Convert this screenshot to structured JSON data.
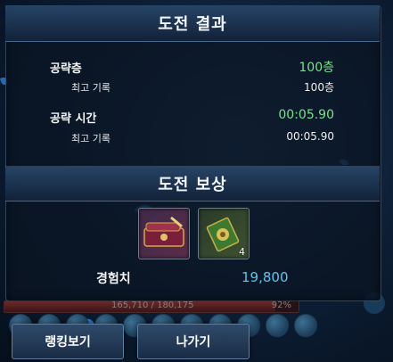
{
  "results": {
    "title": "도전 결과",
    "floor_label": "공략층",
    "floor_value": "100층",
    "floor_best_label": "최고 기록",
    "floor_best_value": "100층",
    "time_label": "공략 시간",
    "time_value": "00:05.90",
    "time_best_label": "최고 기록",
    "time_best_value": "00:05.90"
  },
  "rewards": {
    "title": "도전 보상",
    "items": [
      {
        "icon": "chest-icon",
        "count": ""
      },
      {
        "icon": "scroll-icon",
        "count": "4"
      }
    ],
    "exp_label": "경험치",
    "exp_value": "19,800"
  },
  "xp_bar": {
    "text": "165,710 / 180,175",
    "percent_text": "92%",
    "fraction": 0.92
  },
  "buttons": {
    "ranking": "랭킹보기",
    "exit": "나가기"
  },
  "colors": {
    "green": "#74e48a",
    "exp_blue": "#5fc4ec"
  }
}
